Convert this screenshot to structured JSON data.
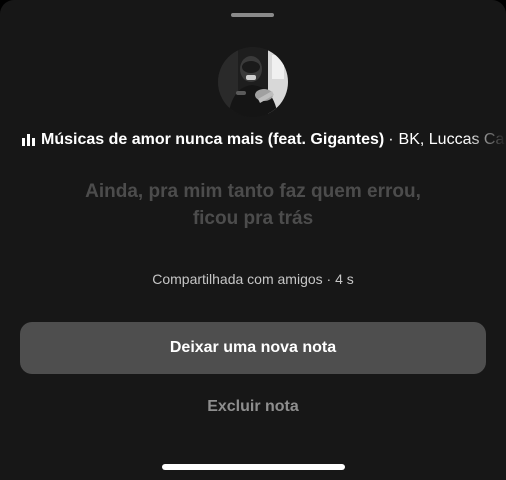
{
  "colors": {
    "background": "#171717",
    "primary_button": "#4e4e4e",
    "lyrics_text": "#4c4c4c",
    "secondary_text": "#8e8e8e"
  },
  "note": {
    "song_icon": "equalizer-bars-icon",
    "song_title": "Músicas de amor nunca mais (feat. Gigantes)",
    "song_separator": "·",
    "song_artists": "BK, Luccas Carlos",
    "lyrics": [
      "Ainda, pra mim tanto faz quem errou,",
      "ficou pra trás"
    ],
    "shared_info": "Compartilhada com amigos · 4 s"
  },
  "actions": {
    "new_note_label": "Deixar uma nova nota",
    "delete_note_label": "Excluir nota"
  }
}
